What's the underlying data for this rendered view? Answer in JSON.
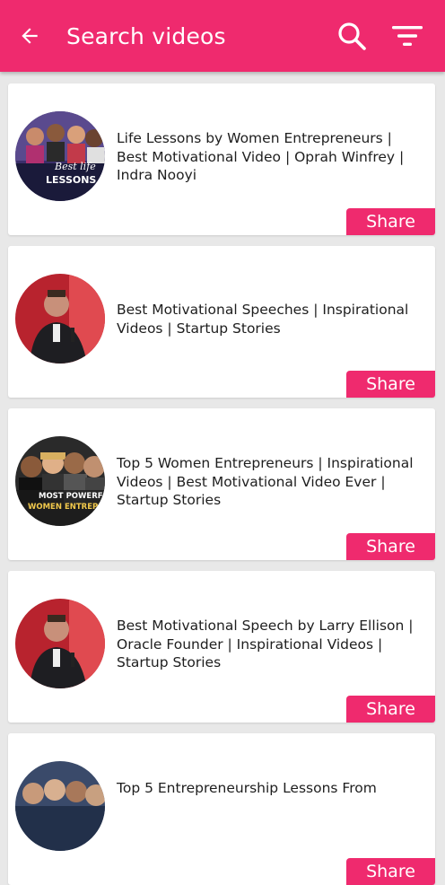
{
  "appbar": {
    "title": "Search videos",
    "back_icon": "arrow-back-icon",
    "search_icon": "search-icon",
    "filter_icon": "filter-icon",
    "color": "#ef2a6e"
  },
  "videos": [
    {
      "title": "Life Lessons by Women Entrepreneurs | Best Motivational Video | Oprah Winfrey | Indra Nooyi",
      "share_label": "Share",
      "thumb_text_1": "Best life",
      "thumb_text_2": "LESSONS"
    },
    {
      "title": "Best Motivational Speeches | Inspirational Videos | Startup Stories",
      "share_label": "Share"
    },
    {
      "title": "Top 5 Women Entrepreneurs | Inspirational Videos | Best Motivational Video Ever | Startup Stories",
      "share_label": "Share",
      "thumb_text_1": "MOST POWERF",
      "thumb_text_2": "WOMEN ENTREPR"
    },
    {
      "title": "Best Motivational Speech by Larry Ellison | Oracle Founder | Inspirational Videos | Startup Stories",
      "share_label": "Share"
    },
    {
      "title": "Top 5 Entrepreneurship Lessons From",
      "share_label": "Share"
    }
  ]
}
